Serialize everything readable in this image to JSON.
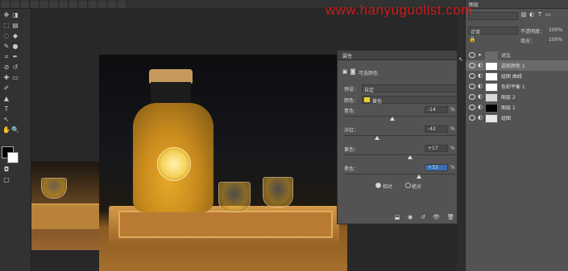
{
  "watermark": {
    "text": "www.hanyuguolist.com"
  },
  "colors": {
    "watermark": "#e01818",
    "highlight": "#3a6fb0",
    "yellow_swatch": "#f0d028"
  },
  "toolbar": {
    "tools": [
      "move-icon",
      "marquee-icon",
      "lasso-icon",
      "quick-select-icon",
      "crop-icon",
      "eyedropper-icon",
      "healing-icon",
      "brush-icon",
      "stamp-icon",
      "history-brush-icon",
      "eraser-icon",
      "gradient-icon",
      "blur-icon",
      "dodge-icon",
      "pen-icon",
      "type-icon",
      "path-select-icon",
      "shape-icon",
      "hand-icon",
      "zoom-icon"
    ]
  },
  "properties": {
    "tab_label": "属性",
    "panel_title": "可选颜色",
    "preset_label": "预设：",
    "preset_value": "自定",
    "colors_label": "颜色：",
    "colors_value": "黄色",
    "sliders": [
      {
        "label": "青色：",
        "value": "-14",
        "unit": "%",
        "pos": 0.43
      },
      {
        "label": "洋红：",
        "value": "-42",
        "unit": "%",
        "pos": 0.29
      },
      {
        "label": "黄色：",
        "value": "+17",
        "unit": "%",
        "pos": 0.585
      },
      {
        "label": "黑色：",
        "value": "+33",
        "unit": "%",
        "pos": 0.665
      }
    ],
    "method_relative": "相对",
    "method_absolute": "绝对"
  },
  "layers": {
    "tab_label": "图层",
    "blend_mode": "正常",
    "opacity_label": "不透明度：",
    "opacity_value": "100%",
    "fill_label": "填充：",
    "fill_value": "100%",
    "items": [
      {
        "name": "对比"
      },
      {
        "name": "选取颜色 1",
        "selected": true
      },
      {
        "name": "组图 曲线"
      },
      {
        "name": "色彩平衡 1"
      },
      {
        "name": "图层 2"
      },
      {
        "name": "图层 1"
      },
      {
        "name": "组图"
      }
    ]
  }
}
